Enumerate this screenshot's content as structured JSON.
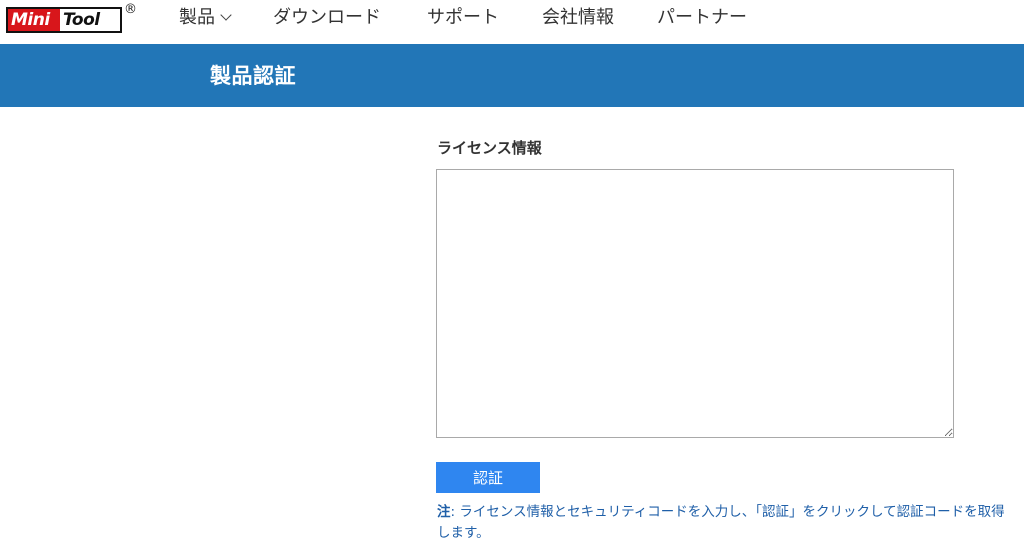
{
  "header": {
    "logo": {
      "mini": "Mini",
      "tool": "Tool",
      "registered": "®"
    },
    "nav": [
      {
        "label": "製品",
        "has_dropdown": true
      },
      {
        "label": "ダウンロード"
      },
      {
        "label": "サポート"
      },
      {
        "label": "会社情報"
      },
      {
        "label": "パートナー"
      }
    ]
  },
  "banner": {
    "title": "製品認証"
  },
  "form": {
    "license_label": "ライセンス情報",
    "license_value": "",
    "submit_label": "認証"
  },
  "note": {
    "label": "注",
    "separator": ":",
    "text": " ライセンス情報とセキュリティコードを入力し、「認証」をクリックして認証コードを取得します。"
  },
  "colors": {
    "banner": "#2276b7",
    "button": "#2f86f0",
    "note_text": "#1f5fa8",
    "logo_red": "#d8161b"
  }
}
